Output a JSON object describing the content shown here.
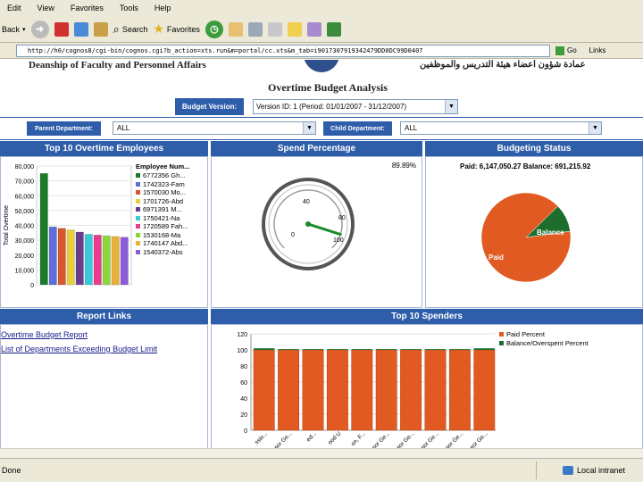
{
  "menu": [
    "Edit",
    "View",
    "Favorites",
    "Tools",
    "Help"
  ],
  "toolbar": {
    "back": "Back",
    "search": "Search",
    "favorites": "Favorites"
  },
  "address": {
    "url": "http://h0/cognos8/cgi-bin/cognos.cgi?b_action=xts.run&m=portal/cc.xts&m_tab=i9017307919342479DD0DC99D0407",
    "go": "Go",
    "links": "Links"
  },
  "header": {
    "dept_title": "Deanship of Faculty and Personnel Affairs",
    "arabic_title": "عمادة شؤون أعضاء هيئة التدريس والموظفين",
    "page_title": "Overtime Budget Analysis"
  },
  "filters": {
    "budget_label": "Budget Version:",
    "budget_value": "Version ID: 1 (Period: 01/01/2007 - 31/12/2007)",
    "parent_label": "Parent Department:",
    "parent_value": "ALL",
    "child_label": "Child Department:",
    "child_value": "ALL"
  },
  "panels": {
    "top_employees": "Top 10 Overtime Employees",
    "spend": "Spend Percentage",
    "budget_status": "Budgeting Status",
    "report_links": "Report Links",
    "top_spenders": "Top 10 Spenders"
  },
  "report_links": [
    "Overtime Budget Report",
    "List of Departments Exceeding Budget Limit"
  ],
  "gauge": {
    "value_text": "89.89%",
    "labels": [
      "0",
      "40",
      "80",
      "100"
    ],
    "value_pct": 89.89
  },
  "budget_pie": {
    "summary": "Paid: 6,147,050.27  Balance: 691,215.92",
    "paid_label": "Paid",
    "balance_label": "Balance"
  },
  "statusbar": {
    "left": "Done",
    "zone": "Local intranet"
  },
  "chart_data": [
    {
      "type": "bar",
      "title": "Top 10 Overtime Employees",
      "ylabel": "Total Overtime",
      "legend_title": "Employee Num...",
      "ylim": [
        0,
        80000
      ],
      "yticks": [
        "0",
        "10,000",
        "20,000",
        "30,000",
        "40,000",
        "50,000",
        "60,000",
        "70,000",
        "80,000"
      ],
      "categories": [
        "6772356 Gh...",
        "1742323-Fam",
        "1570030 Mo...",
        "1701726-Abd",
        "6971391 M...",
        "1750421-Na",
        "1720589 Fah...",
        "1530168-Ma",
        "1740147 Abd...",
        "1540372-Abs"
      ],
      "values": [
        75000,
        39000,
        38000,
        37000,
        35500,
        34000,
        33500,
        33000,
        32500,
        32000
      ],
      "colors": [
        "#1a7a2a",
        "#5f6fd8",
        "#d8582c",
        "#e8d03c",
        "#6a3c90",
        "#3cc8d8",
        "#e83c8c",
        "#8cd83c",
        "#e8b03c",
        "#8c5cd8"
      ]
    },
    {
      "type": "pie",
      "title": "Budgeting Status",
      "slices": [
        {
          "label": "Paid",
          "value": 6147050.27,
          "color": "#e05a22"
        },
        {
          "label": "Balance",
          "value": 691215.92,
          "color": "#1d6e2d"
        }
      ]
    },
    {
      "type": "bar",
      "title": "Top 10 Spenders",
      "ylim": [
        0,
        120
      ],
      "yticks": [
        "0",
        "20",
        "40",
        "60",
        "80",
        "100",
        "120"
      ],
      "categories": [
        "ssio...",
        "sor Ge...",
        "ed...",
        "ood U",
        "on, F...",
        "sor Ge...",
        "sor Ge...",
        "sor Ge...",
        "sor Ge...",
        "sor Ge..."
      ],
      "series": [
        {
          "name": "Paid Percent",
          "values": [
            100,
            100,
            100,
            100,
            100,
            100,
            100,
            100,
            100,
            100
          ],
          "color": "#e05a22"
        },
        {
          "name": "Balance/Overspent Percent",
          "values": [
            2,
            1,
            1,
            1,
            1,
            1,
            1,
            1,
            1,
            2
          ],
          "color": "#1d6e2d"
        }
      ]
    }
  ]
}
